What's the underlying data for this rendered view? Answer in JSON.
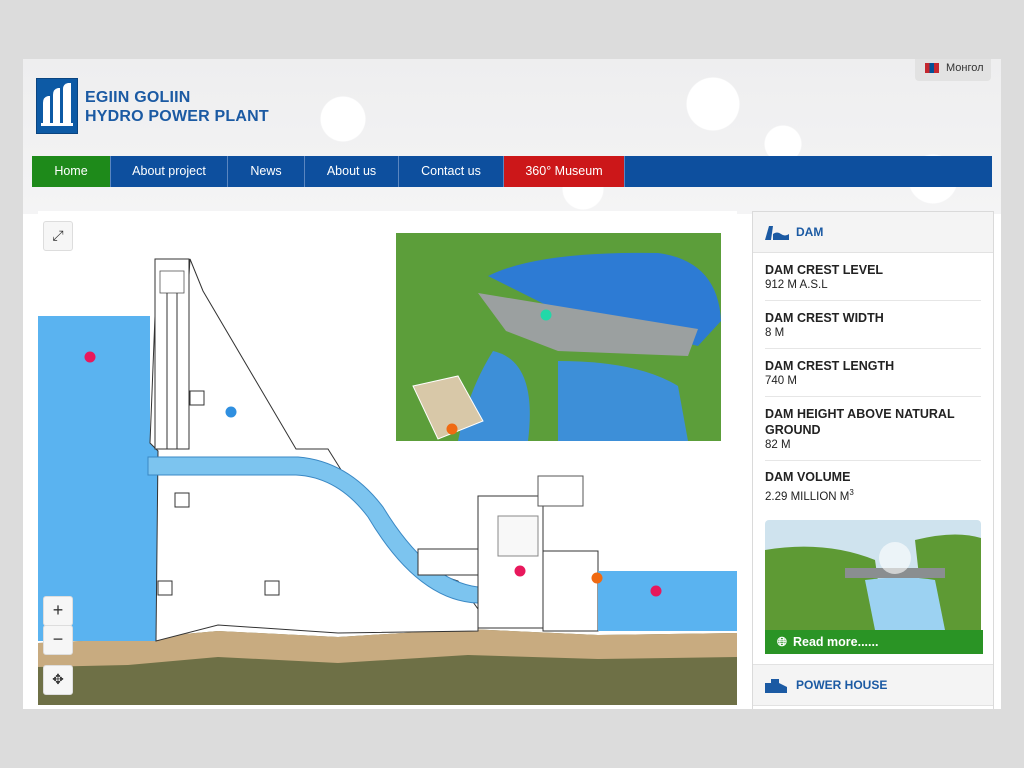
{
  "brand": {
    "line1": "EGIIN GOLIIN",
    "line2": "HYDRO POWER PLANT",
    "color": "#1b5aa3"
  },
  "language": {
    "label": "Монгол",
    "flag_icon": "mongolia-flag-icon"
  },
  "nav": [
    {
      "label": "Home",
      "bg": "#1e8a1a"
    },
    {
      "label": "About project",
      "bg": "#0d4f9e"
    },
    {
      "label": "News",
      "bg": "#0d4f9e"
    },
    {
      "label": "About us",
      "bg": "#0d4f9e"
    },
    {
      "label": "Contact us",
      "bg": "#0d4f9e"
    },
    {
      "label": "360° Museum",
      "bg": "#cc1719"
    }
  ],
  "map_controls": {
    "fullscreen_icon": "fullscreen-icon",
    "zoom_in": "+",
    "zoom_out": "−",
    "recenter_icon": "move-icon"
  },
  "sidebar": {
    "dam_title": "DAM",
    "stats": [
      {
        "label": "DAM CREST LEVEL",
        "value": "912 M A.S.L"
      },
      {
        "label": "DAM CREST WIDTH",
        "value": "8 M"
      },
      {
        "label": "DAM CREST LENGTH",
        "value": "740 M"
      },
      {
        "label": "DAM HEIGHT ABOVE NATURAL GROUND",
        "value": "82 M"
      },
      {
        "label": "DAM VOLUME",
        "value": "2.29 MILLION M",
        "sup": "3"
      }
    ],
    "read_more": "Read more......",
    "power_house_title": "POWER HOUSE"
  },
  "colors": {
    "accent_green": "#2a9425",
    "nav_blue": "#0d4f9e",
    "museum_red": "#cc1719",
    "water": "#5ab3f0"
  }
}
